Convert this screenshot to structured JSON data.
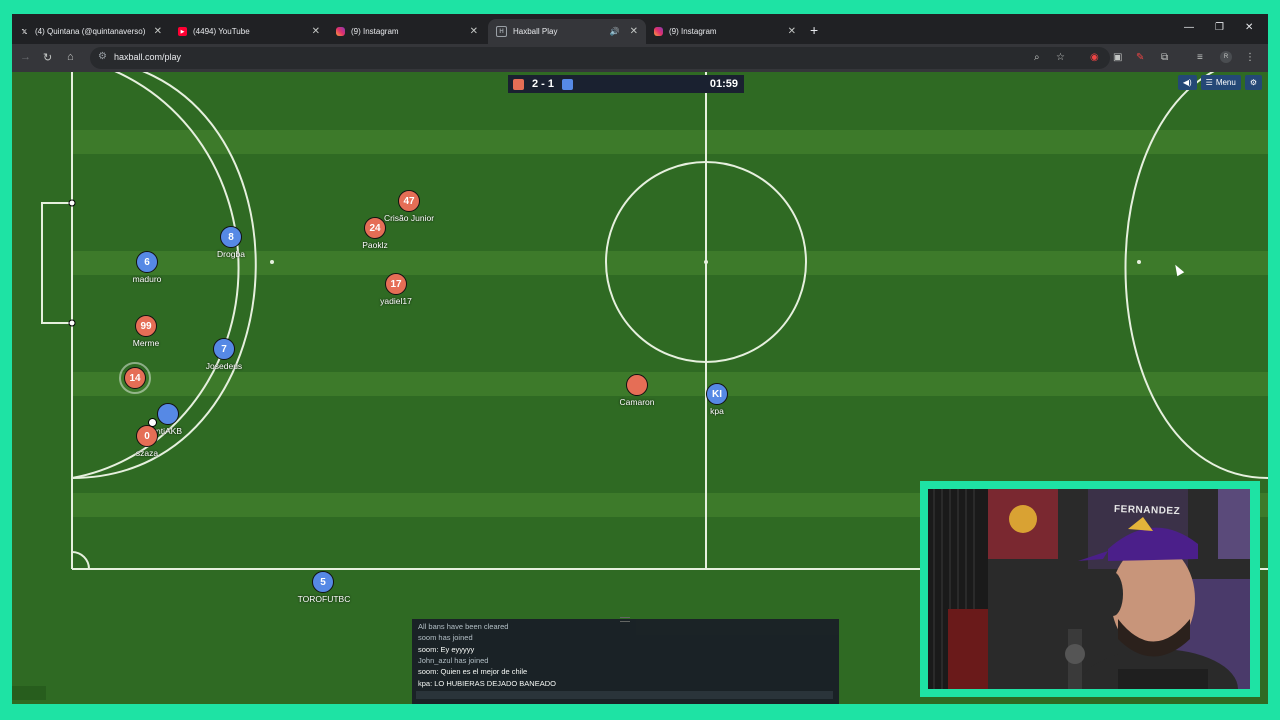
{
  "browser": {
    "tabs": [
      {
        "title": "(4) Quintana (@quintanaverso)",
        "icon": "x-logo-icon",
        "active": false
      },
      {
        "title": "(4494) YouTube",
        "icon": "youtube-icon",
        "active": false
      },
      {
        "title": "(9) Instagram",
        "icon": "instagram-icon",
        "active": false
      },
      {
        "title": "Haxball Play",
        "icon": "haxball-icon",
        "active": true
      },
      {
        "title": "(9) Instagram",
        "icon": "instagram-icon",
        "active": false
      }
    ],
    "url": "haxball.com/play"
  },
  "game": {
    "score": "2 - 1",
    "timer": "01:59",
    "menu_label": "Menu",
    "colors": {
      "red": "#e56e56",
      "blue": "#5689e5",
      "field": "#2f6a23",
      "stripe": "#3d7a2a"
    },
    "players": [
      {
        "number": "47",
        "name": "Crisão Junior",
        "team": "red"
      },
      {
        "number": "24",
        "name": "Paoklz",
        "team": "red"
      },
      {
        "number": "17",
        "name": "yadiel17",
        "team": "red"
      },
      {
        "number": "99",
        "name": "Merme",
        "team": "red"
      },
      {
        "number": "14",
        "name": "",
        "team": "red"
      },
      {
        "number": "0",
        "name": "szaza",
        "team": "red"
      },
      {
        "number": "",
        "name": "Camaron",
        "team": "red"
      },
      {
        "number": "8",
        "name": "Drogba",
        "team": "blue"
      },
      {
        "number": "6",
        "name": "maduro",
        "team": "blue"
      },
      {
        "number": "7",
        "name": "Josedeus",
        "team": "blue"
      },
      {
        "number": "",
        "name": "ntiAKB",
        "team": "blue"
      },
      {
        "number": "KI",
        "name": "kpa",
        "team": "blue"
      },
      {
        "number": "5",
        "name": "TOROFUTBC",
        "team": "blue"
      }
    ]
  },
  "chat": {
    "lines": [
      {
        "text": "All bans have been cleared",
        "type": "sys"
      },
      {
        "text": "soom has joined",
        "type": "sys"
      },
      {
        "text": "soom: Ey eyyyyy",
        "type": "msg"
      },
      {
        "text": "John_azul has joined",
        "type": "sys"
      },
      {
        "text": "soom: Quien es el mejor de chile",
        "type": "msg"
      },
      {
        "text": "kpa: LO HUBIERAS DEJADO BANEADO",
        "type": "msg"
      }
    ]
  },
  "webcam": {
    "poster_text": "FERNANDEZ"
  }
}
